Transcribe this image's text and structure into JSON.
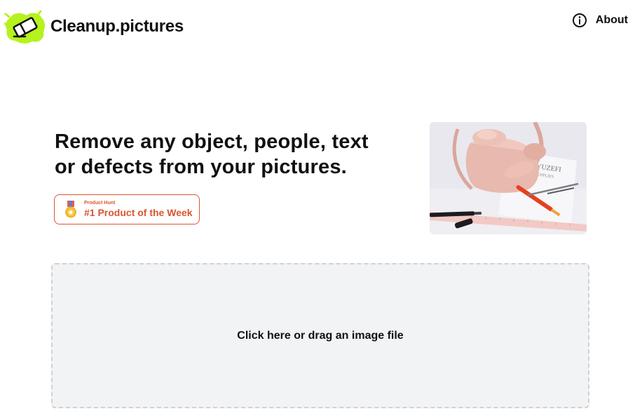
{
  "header": {
    "brand": "Cleanup.pictures",
    "logo_icon": "eraser-icon",
    "logo_color": "#b6f21e",
    "about_label": "About",
    "about_icon": "info-circle-icon"
  },
  "hero": {
    "title_line1": "Remove any object, people, text",
    "title_line2": "or defects from your pictures.",
    "badge": {
      "small_label": "Product Hunt",
      "main_label": "#1 Product of the Week",
      "icon": "medal-icon",
      "color": "#da552f"
    },
    "photo": {
      "icon": "sample-photo",
      "visible_text_line1": "YUZEFI",
      "visible_text_line2": "SUPPLIES"
    }
  },
  "dropzone": {
    "label": "Click here or drag an image file"
  }
}
